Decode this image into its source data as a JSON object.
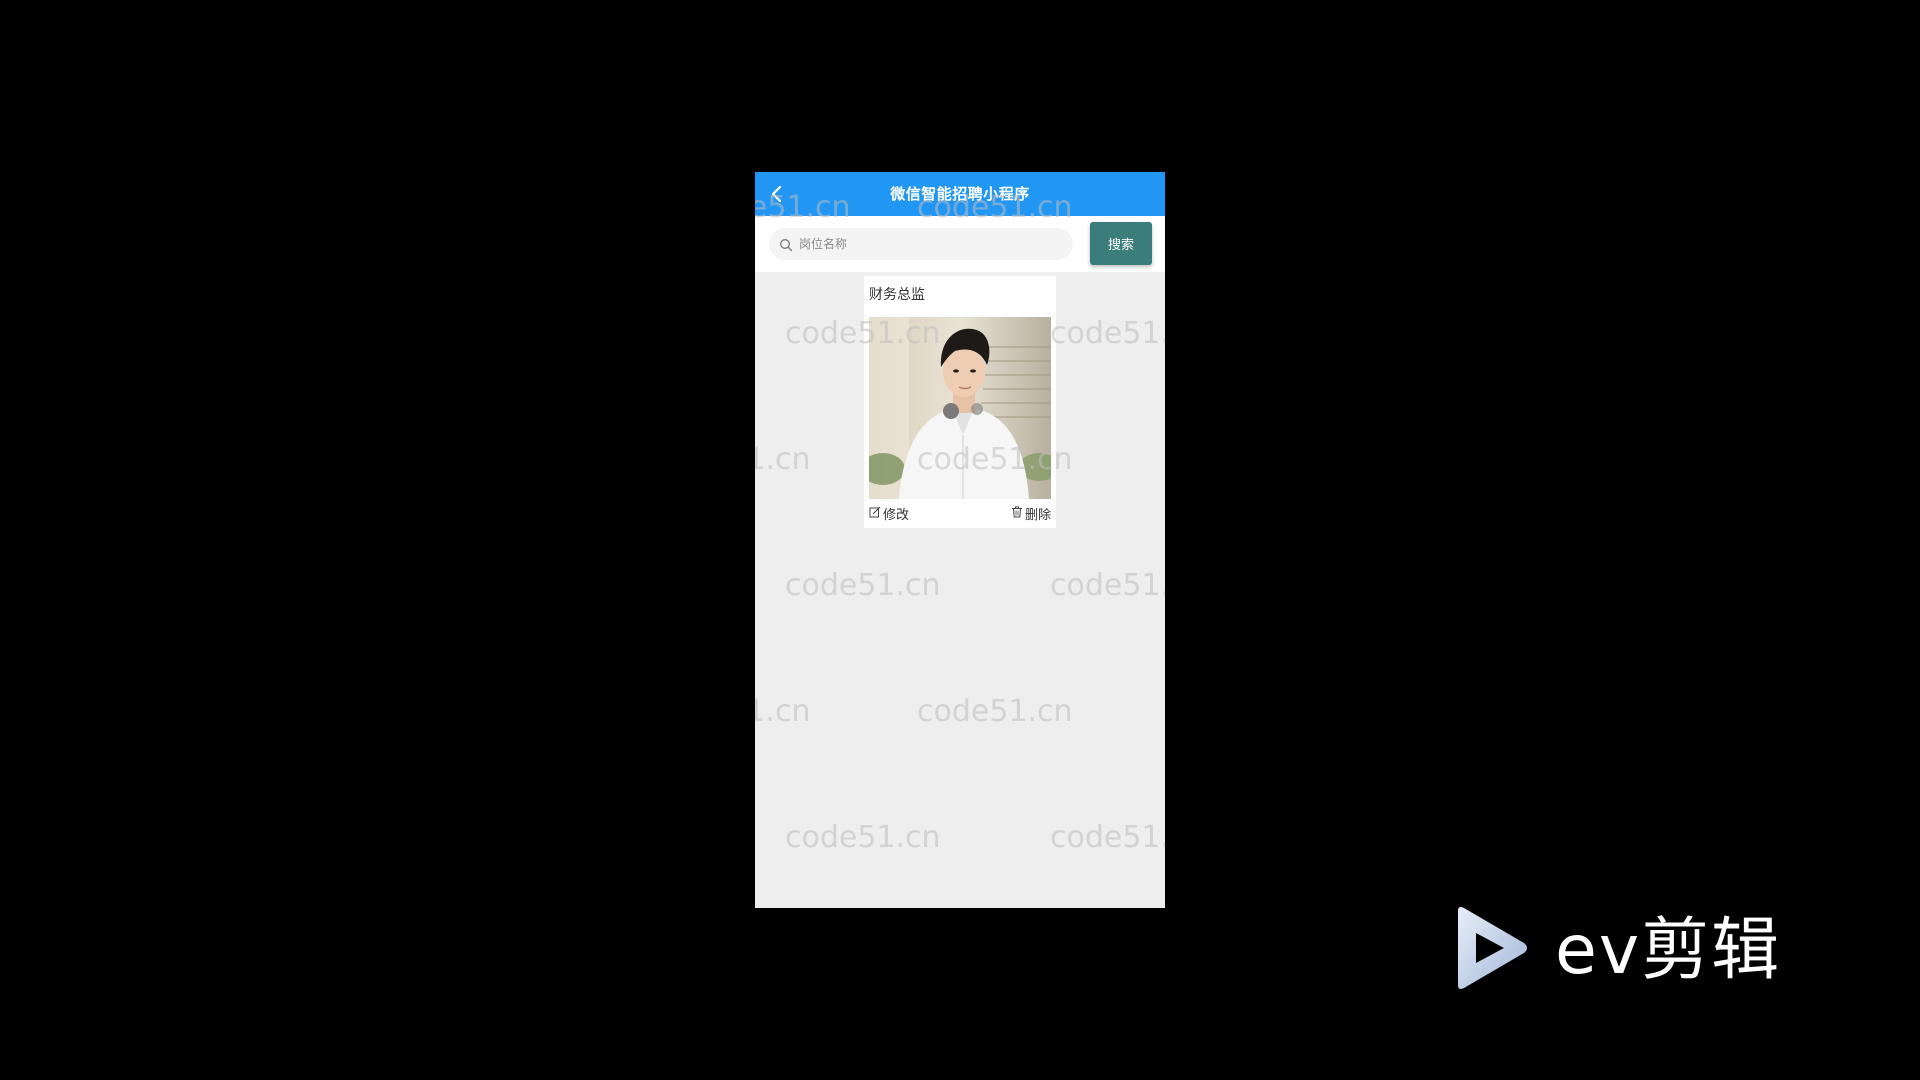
{
  "app": {
    "title": "微信智能招聘小程序"
  },
  "search": {
    "placeholder": "岗位名称",
    "value": "",
    "button_label": "搜索"
  },
  "jobs": [
    {
      "title": "财务总监",
      "edit_label": "修改",
      "delete_label": "删除"
    }
  ],
  "watermark": "code51.cn",
  "brand": {
    "logo_text": "ev剪辑"
  },
  "colors": {
    "nav_bar": "#2196f3",
    "search_button": "#3b7d7b",
    "page_background": "#eeeeee",
    "outer_background": "#000000"
  }
}
